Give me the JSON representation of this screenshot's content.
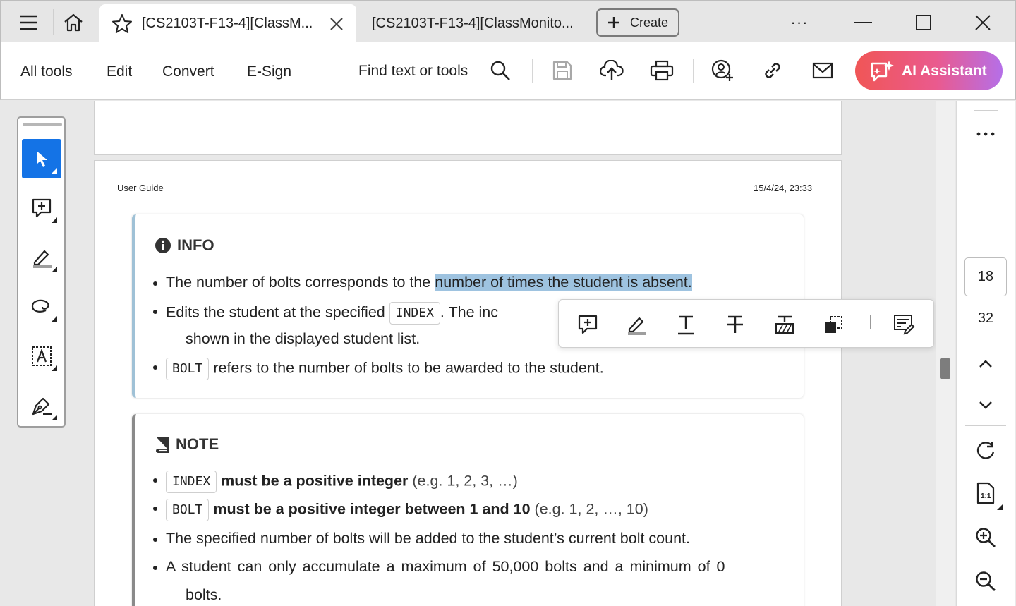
{
  "tabs": [
    {
      "label": "[CS2103T-F13-4][ClassM...",
      "active": true
    },
    {
      "label": "[CS2103T-F13-4][ClassMonito...",
      "active": false
    }
  ],
  "tabbar": {
    "create_label": "Create",
    "more_label": "···"
  },
  "toolbar": {
    "menu": [
      "All tools",
      "Edit",
      "Convert",
      "E-Sign"
    ],
    "find_label": "Find text or tools",
    "ai_label": "AI Assistant"
  },
  "document": {
    "header_left": "User Guide",
    "header_right": "15/4/24, 23:33",
    "info": {
      "title": "INFO",
      "b1_pre": "The number of bolts corresponds to the ",
      "b1_hl": "number of times the student is absent.",
      "b2_pre": "Edits the student at the specified ",
      "b2_code": "INDEX",
      "b2_post": ". The inc",
      "b2_cont": "shown in the displayed student list.",
      "b3_code": "BOLT",
      "b3_post": " refers to the number of bolts to be awarded to the student."
    },
    "note": {
      "title": "NOTE",
      "b1_code": "INDEX",
      "b1_bold": " must be a positive integer",
      "b1_post": " (e.g. 1, 2, 3, …)",
      "b2_code": "BOLT",
      "b2_bold": " must be a positive integer between 1 and 10",
      "b2_post": " (e.g. 1, 2, …, 10)",
      "b3": "The specified number of bolts will be added to the student’s current bolt count.",
      "b4": "A student can only accumulate a maximum of 50,000 bolts and a minimum of 0",
      "b4_cont": "bolts."
    }
  },
  "pagenav": {
    "current": "18",
    "total": "32"
  },
  "colors": {
    "accent": "#1473e6",
    "highlight": "#9ec3e0",
    "info_border": "#9fc1d6",
    "note_border": "#8a8a8a"
  }
}
